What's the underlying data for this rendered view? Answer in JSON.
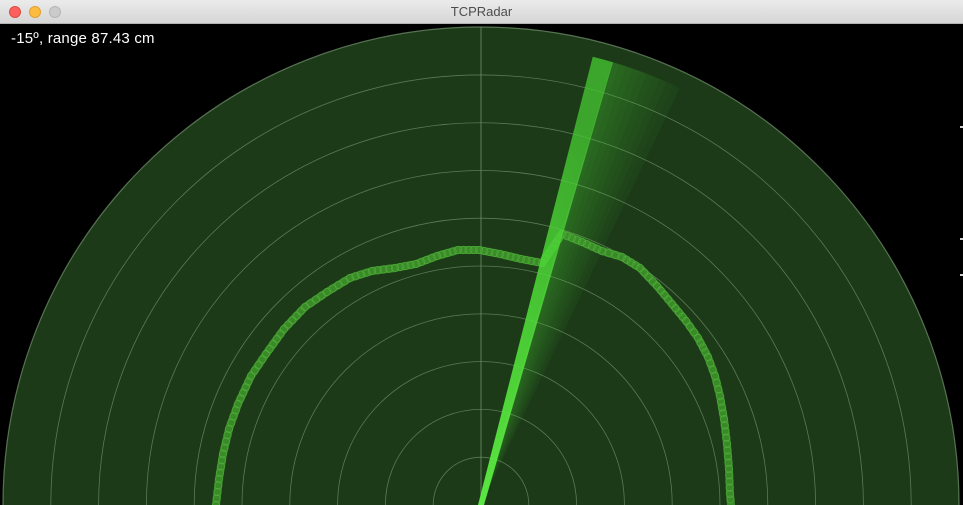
{
  "window": {
    "title": "TCPRadar"
  },
  "readout": {
    "text": "-15º, range 87.43 cm"
  },
  "radar": {
    "sweep_angle_deg": -15,
    "range_cm": 87.43,
    "ring_count": 10,
    "background_color": "#1c3a18",
    "grid_color": "#6f8f6a",
    "beam_color": "#4fe63a",
    "echo_color": "#3f9a2c"
  }
}
